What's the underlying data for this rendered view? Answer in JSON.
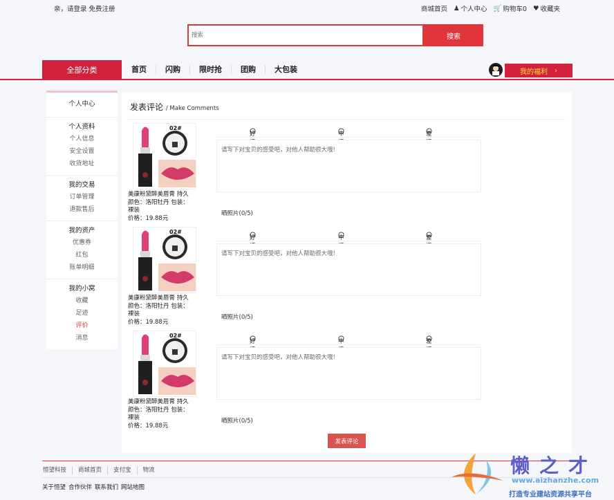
{
  "topbar": {
    "greeting": "亲，请登录",
    "register": "免费注册",
    "links": [
      "商城首页",
      "个人中心",
      "购物车0",
      "收藏夹"
    ]
  },
  "search": {
    "placeholder": "搜索",
    "button": "搜索"
  },
  "nav": {
    "all_categories": "全部分类",
    "links": [
      "首页",
      "闪购",
      "限时抢",
      "团购",
      "大包装"
    ],
    "welfare": "我的福利",
    "welfare_arrow": "›"
  },
  "sidebar": {
    "title": "个人中心",
    "groups": [
      {
        "title": "个人资料",
        "items": [
          "个人信息",
          "安全设置",
          "收货地址"
        ]
      },
      {
        "title": "我的交易",
        "items": [
          "订单管理",
          "退款售后"
        ]
      },
      {
        "title": "我的资产",
        "items": [
          "优惠券",
          "红包",
          "账单明细"
        ]
      },
      {
        "title": "我的小窝",
        "items": [
          "收藏",
          "足迹",
          "评价",
          "消息"
        ]
      }
    ],
    "active_item": "评价"
  },
  "main": {
    "title": "发表评论",
    "subtitle": "/ Make Comments",
    "ratings": [
      "好评",
      "中评",
      "差评"
    ],
    "comment_placeholder": "请写下对宝贝的感受吧，对他人帮助很大哦!",
    "photo_label": "晒照片(0/5)",
    "submit": "发表评论",
    "product_badge": "02#",
    "products": [
      {
        "name": "美康粉黛醉美唇膏 持久",
        "color": "颜色：洛阳牡丹 包装：",
        "pack": "裸装",
        "price": "价格：19.88元"
      },
      {
        "name": "美康粉黛醉美唇膏 持久",
        "color": "颜色：洛阳牡丹 包装：",
        "pack": "裸装",
        "price": "价格：19.88元"
      },
      {
        "name": "美康粉黛醉美唇膏 持久",
        "color": "颜色：洛阳牡丹 包装：",
        "pack": "裸装",
        "price": "价格：19.88元"
      }
    ]
  },
  "footer": {
    "links": [
      "恒望科技",
      "商城首页",
      "支付宝",
      "物流"
    ],
    "links2": [
      "关于恒望",
      "合作伙伴",
      "联系我们",
      "网站地图"
    ]
  },
  "watermark": {
    "name": "懒之才",
    "url": "www.aizhanzhe.com",
    "slogan": "打造专业建站资源共享平台"
  },
  "colors": {
    "accent": "#e0363b",
    "nav_red": "#d2213c",
    "welfare_text": "#ffe22a"
  }
}
